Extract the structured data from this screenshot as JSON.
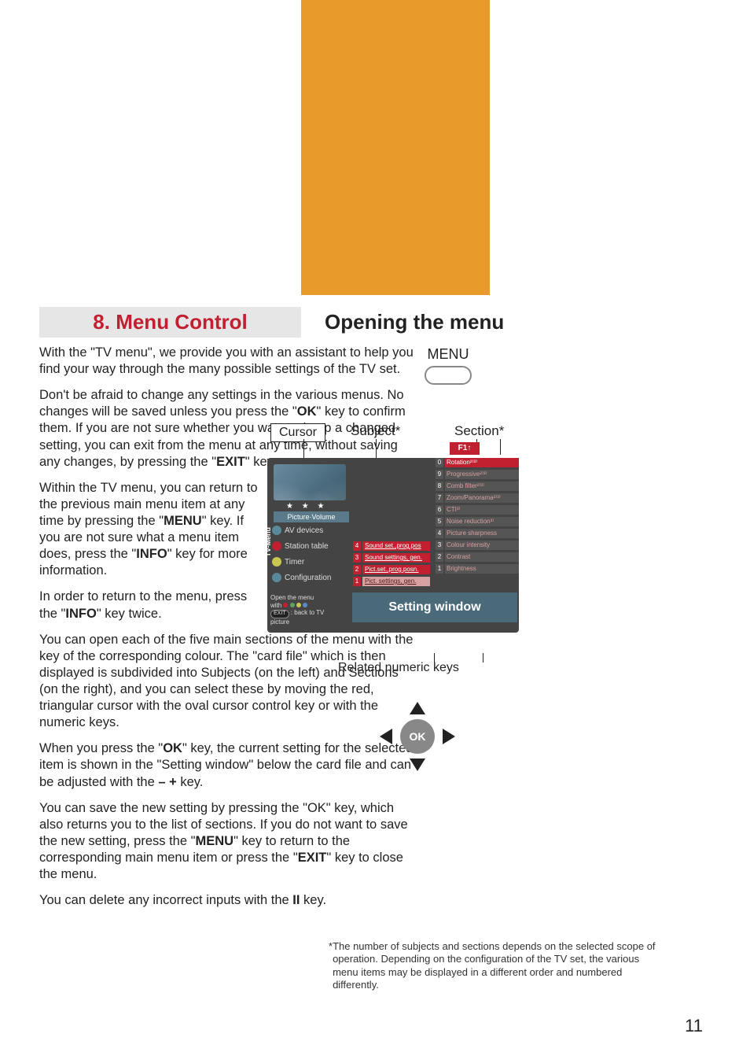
{
  "headings": {
    "left": "8. Menu Control",
    "right": "Opening the menu"
  },
  "paragraphs": {
    "p1": "With the \"TV menu\", we provide you with an assistant to help you find your way through the many possible settings of the TV set.",
    "p2a": "Don't be afraid to change any settings in the various menus. No changes will be saved unless you press the \"",
    "p2b": "\" key to confirm them. If you are not sure whether you want to keep a changed setting, you can exit from the menu at any time, without saving any changes, by pressing the \"",
    "p2c": "\" key.",
    "p3a": "Within the TV menu, you can return to the previous main menu item at any time by pressing the \"",
    "p3b": "\" key. If you are not sure what a menu item does, press the \"",
    "p3c": "\" key for more information.",
    "p4a": "In order to return to the menu, press the \"",
    "p4b": "\" key twice.",
    "p5": "You can open each of the five main sections of the menu with the key of the corresponding colour. The \"card file\" which is then displayed is subdivided into Subjects (on the left) and Sections (on the right), and you can select these by moving the red, triangular cursor with the oval cursor control key or with the numeric keys.",
    "p6a": "When you press the \"",
    "p6b": "\" key, the current setting for the selected item is shown in the \"Setting window\" below the card file and can be adjusted with the ",
    "p6c": " key.",
    "p7a": "You can save the new setting by pressing the \"OK\" key, which also returns you to the list of sections. If you do not want to save the new setting, press the \"",
    "p7b": "\" key to return to the corresponding main menu item or press the \"",
    "p7c": "\" key to close the menu.",
    "p8a": "You can delete any incorrect inputs with the ",
    "p8b": " key."
  },
  "bold": {
    "ok": "OK",
    "exit": "EXIT",
    "menu": "MENU",
    "info": "INFO",
    "minusplus": "– +",
    "ii": "II"
  },
  "labels": {
    "menu": "MENU",
    "cursor": "Cursor",
    "subject": "Subject*",
    "section": "Section*",
    "f1": "F1↑",
    "setting_window": "Setting window",
    "related": "Related numeric keys",
    "ok": "OK",
    "stars": "★ ★ ★",
    "pv": "Picture·Volume",
    "tv_menu": "TV-Menu",
    "open_menu": "Open the menu",
    "with": "with",
    "exit_pill": "EXIT",
    "back_to_tv": ": back to TV",
    "picture": "picture"
  },
  "left_menu": [
    {
      "label": "AV devices",
      "color": "#5a8a9a"
    },
    {
      "label": "Station table",
      "color": "#c02030"
    },
    {
      "label": "Timer",
      "color": "#c8c850"
    },
    {
      "label": "Configuration",
      "color": "#5a8a9a"
    }
  ],
  "subjects": [
    {
      "n": "4",
      "label": "Sound set.,prog.pos",
      "light": false
    },
    {
      "n": "3",
      "label": "Sound settings, gen.",
      "light": false
    },
    {
      "n": "2",
      "label": "Pict.set.,prog.posn.",
      "light": false
    },
    {
      "n": "1",
      "label": "Pict. settings, gen.",
      "light": true
    }
  ],
  "sections": [
    {
      "n": "0",
      "label": "Rotation²⁾³⁾",
      "hl": true
    },
    {
      "n": "9",
      "label": "Progressive²⁾³⁾",
      "hl": false
    },
    {
      "n": "8",
      "label": "Comb filter²⁾³⁾",
      "hl": false
    },
    {
      "n": "7",
      "label": "Zoom/Panorama²⁾³⁾",
      "hl": false
    },
    {
      "n": "6",
      "label": "CTI³⁾",
      "hl": false
    },
    {
      "n": "5",
      "label": "Noise reduction³⁾",
      "hl": false
    },
    {
      "n": "4",
      "label": "Picture sharpness",
      "hl": false
    },
    {
      "n": "3",
      "label": "Colour intensity",
      "hl": false
    },
    {
      "n": "2",
      "label": "Contrast",
      "hl": false
    },
    {
      "n": "1",
      "label": "Brightness",
      "hl": false
    }
  ],
  "footnote": {
    "star": "*",
    "text": "The number of subjects and sections depends on the selected scope of operation. Depending on the configuration of the TV set, the various menu items may be displayed in a different order and numbered differently."
  },
  "page": "11"
}
